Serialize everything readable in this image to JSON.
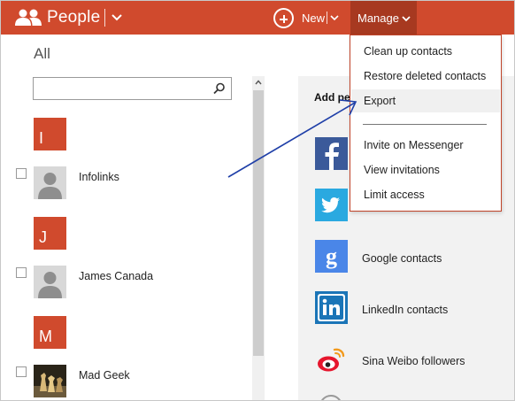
{
  "header": {
    "app_title": "People",
    "new_label": "New",
    "manage_label": "Manage",
    "bar_color": "#d04a2d",
    "manage_active_color": "#a73920"
  },
  "list": {
    "section_title": "All",
    "search_placeholder": "",
    "groups": [
      {
        "letter": "I",
        "contact": "Infolinks",
        "avatar": "person-silhouette"
      },
      {
        "letter": "J",
        "contact": "James Canada",
        "avatar": "person-silhouette"
      },
      {
        "letter": "M",
        "contact": "Mad Geek",
        "avatar": "chess-pieces-photo"
      }
    ]
  },
  "panel": {
    "title": "Add pe",
    "services": [
      {
        "icon": "facebook-icon",
        "label": ""
      },
      {
        "icon": "twitter-icon",
        "label": ""
      },
      {
        "icon": "google-icon",
        "label": "Google contacts"
      },
      {
        "icon": "linkedin-icon",
        "label": "LinkedIn contacts"
      },
      {
        "icon": "sina-weibo-icon",
        "label": "Sina Weibo followers"
      }
    ]
  },
  "menu": {
    "items": [
      {
        "label": "Clean up contacts"
      },
      {
        "label": "Restore deleted contacts"
      },
      {
        "label": "Export",
        "highlighted": true
      },
      {
        "label": "Invite on Messenger"
      },
      {
        "label": "View invitations"
      },
      {
        "label": "Limit access"
      }
    ]
  },
  "colors": {
    "accent": "#d04a2d",
    "arrow": "#1f3fa8"
  }
}
